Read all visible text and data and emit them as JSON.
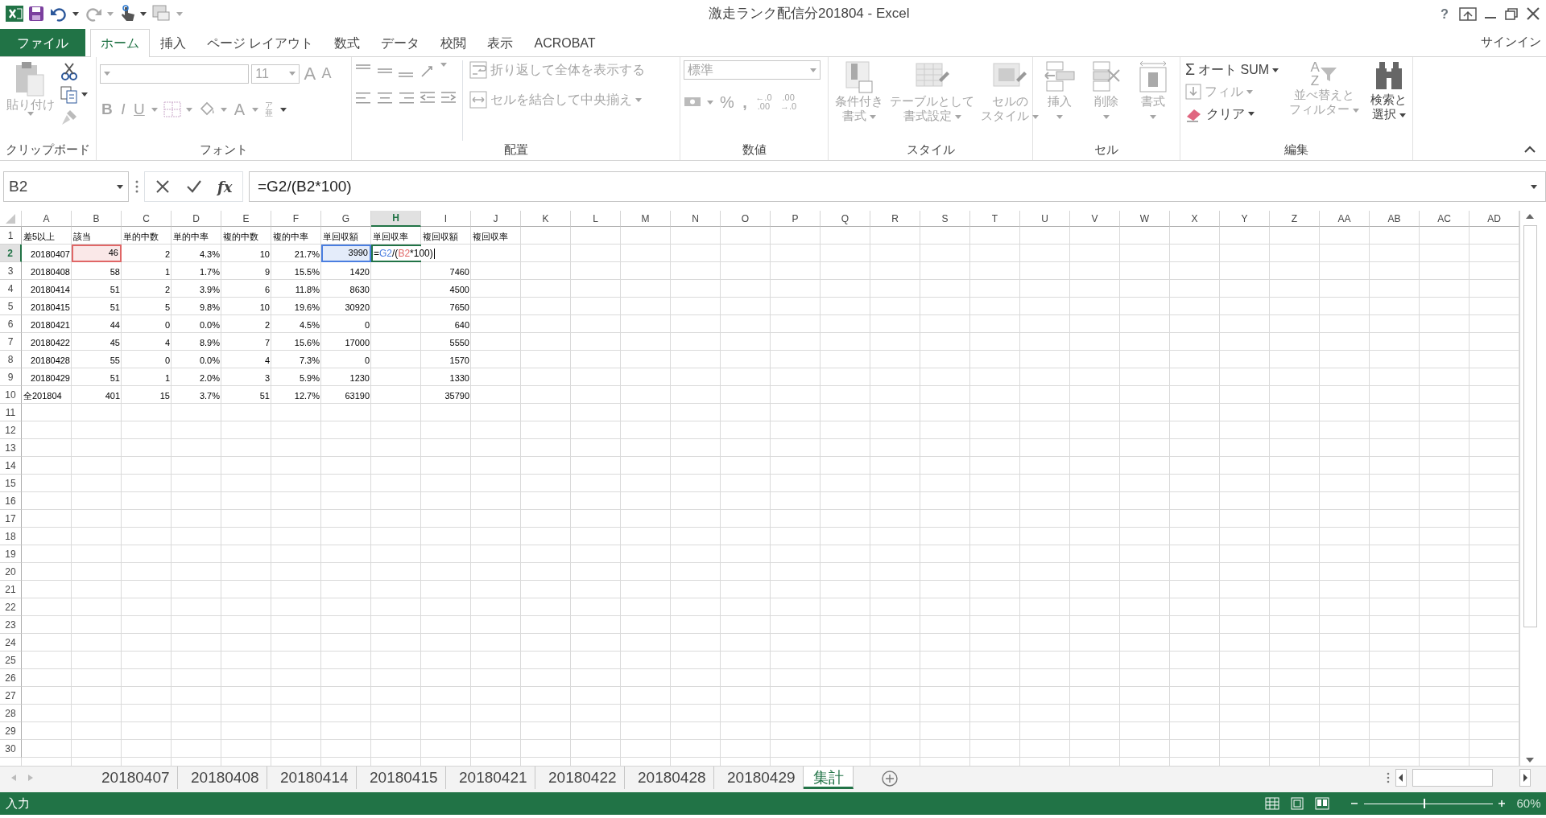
{
  "window": {
    "title": "激走ランク配信分201804 - Excel",
    "help": "?",
    "signin": "サインイン"
  },
  "ribbon_tabs": [
    {
      "label": "ファイル",
      "kind": "file",
      "selected": false
    },
    {
      "label": "ホーム",
      "kind": "tab",
      "selected": true
    },
    {
      "label": "挿入",
      "kind": "tab",
      "selected": false
    },
    {
      "label": "ページ レイアウト",
      "kind": "tab",
      "selected": false
    },
    {
      "label": "数式",
      "kind": "tab",
      "selected": false
    },
    {
      "label": "データ",
      "kind": "tab",
      "selected": false
    },
    {
      "label": "校閲",
      "kind": "tab",
      "selected": false
    },
    {
      "label": "表示",
      "kind": "tab",
      "selected": false
    },
    {
      "label": "ACROBAT",
      "kind": "tab",
      "selected": false
    }
  ],
  "ribbon": {
    "clipboard": {
      "label": "クリップボード",
      "paste": {
        "label": "貼り付け",
        "disabled": true
      }
    },
    "font": {
      "label": "フォント",
      "font_size": "11",
      "grow": "A",
      "shrink": "A",
      "bold": "B",
      "italic": "I",
      "underline": "U",
      "font_color": "A",
      "phonetic": [
        "ア",
        "亜"
      ],
      "disabled": true
    },
    "alignment": {
      "label": "配置",
      "wrap": "折り返して全体を表示する",
      "merge": "セルを結合して中央揃え",
      "disabled": true
    },
    "number": {
      "label": "数値",
      "format": "標準",
      "percent": "%",
      "comma": ",",
      "increase_decimal": [
        "←.0",
        ".00"
      ],
      "decrease_decimal": [
        ".00",
        "→.0"
      ],
      "disabled": true
    },
    "styles": {
      "label": "スタイル",
      "buttons": [
        {
          "lines": [
            "条件付き",
            "書式"
          ],
          "disabled": true
        },
        {
          "lines": [
            "テーブルとして",
            "書式設定"
          ],
          "disabled": true
        },
        {
          "lines": [
            "セルの",
            "スタイル"
          ],
          "disabled": true
        }
      ]
    },
    "cells": {
      "label": "セル",
      "buttons": [
        {
          "label": "挿入",
          "disabled": true
        },
        {
          "label": "削除",
          "disabled": true
        },
        {
          "label": "書式",
          "disabled": true
        }
      ]
    },
    "editing": {
      "label": "編集",
      "autosum": {
        "icon": "Σ",
        "label": "オート SUM",
        "disabled": false
      },
      "fill": {
        "label": "フィル",
        "disabled": true
      },
      "clear": {
        "label": "クリア",
        "disabled": false
      },
      "sort": {
        "letters": [
          "A",
          "Z"
        ],
        "lines": [
          "並べ替えと",
          "フィルター"
        ],
        "disabled": true
      },
      "find": {
        "lines": [
          "検索と",
          "選択"
        ],
        "disabled": false
      }
    }
  },
  "formula_bar": {
    "name_box": "B2",
    "fx": "fx",
    "formula": "=G2/(B2*100)"
  },
  "columns": [
    {
      "label": "A",
      "selected": false
    },
    {
      "label": "B",
      "selected": false
    },
    {
      "label": "C",
      "selected": false
    },
    {
      "label": "D",
      "selected": false
    },
    {
      "label": "E",
      "selected": false
    },
    {
      "label": "F",
      "selected": false
    },
    {
      "label": "G",
      "selected": false
    },
    {
      "label": "H",
      "selected": true
    },
    {
      "label": "I",
      "selected": false
    },
    {
      "label": "J",
      "selected": false
    },
    {
      "label": "K",
      "selected": false
    },
    {
      "label": "L",
      "selected": false
    },
    {
      "label": "M",
      "selected": false
    },
    {
      "label": "N",
      "selected": false
    },
    {
      "label": "O",
      "selected": false
    },
    {
      "label": "P",
      "selected": false
    },
    {
      "label": "Q",
      "selected": false
    },
    {
      "label": "R",
      "selected": false
    },
    {
      "label": "S",
      "selected": false
    },
    {
      "label": "T",
      "selected": false
    },
    {
      "label": "U",
      "selected": false
    },
    {
      "label": "V",
      "selected": false
    },
    {
      "label": "W",
      "selected": false
    },
    {
      "label": "X",
      "selected": false
    },
    {
      "label": "Y",
      "selected": false
    },
    {
      "label": "Z",
      "selected": false
    },
    {
      "label": "AA",
      "selected": false
    },
    {
      "label": "AB",
      "selected": false
    },
    {
      "label": "AC",
      "selected": false
    },
    {
      "label": "AD",
      "selected": false
    }
  ],
  "rows": [
    {
      "header": "1",
      "selected": false,
      "cells": [
        "差5以上",
        "該当",
        "単的中数",
        "単的中率",
        "複的中数",
        "複的中率",
        "単回収額",
        "単回収率",
        "複回収額",
        "複回収率"
      ]
    },
    {
      "header": "2",
      "selected": true,
      "cells": [
        "20180407",
        {
          "text": "46",
          "color": "#e06666"
        },
        "2",
        "4.3%",
        "10",
        "21.7%",
        {
          "text": "3990",
          "color": "#4a7ee0"
        },
        {
          "kind": "editing",
          "parts": [
            {
              "text": "="
            },
            {
              "text": "G2",
              "color": "#4a7ee0"
            },
            {
              "text": "/("
            },
            {
              "text": "B2",
              "color": "#e06666"
            },
            {
              "text": "*100)"
            }
          ]
        }
      ]
    },
    {
      "header": "3",
      "selected": false,
      "cells": [
        "20180408",
        "58",
        "1",
        "1.7%",
        "9",
        "15.5%",
        "1420",
        null,
        "7460"
      ]
    },
    {
      "header": "4",
      "selected": false,
      "cells": [
        "20180414",
        "51",
        "2",
        "3.9%",
        "6",
        "11.8%",
        "8630",
        null,
        "4500"
      ]
    },
    {
      "header": "5",
      "selected": false,
      "cells": [
        "20180415",
        "51",
        "5",
        "9.8%",
        "10",
        "19.6%",
        "30920",
        null,
        "7650"
      ]
    },
    {
      "header": "6",
      "selected": false,
      "cells": [
        "20180421",
        "44",
        "0",
        "0.0%",
        "2",
        "4.5%",
        "0",
        null,
        "640"
      ]
    },
    {
      "header": "7",
      "selected": false,
      "cells": [
        "20180422",
        "45",
        "4",
        "8.9%",
        "7",
        "15.6%",
        "17000",
        null,
        "5550"
      ]
    },
    {
      "header": "8",
      "selected": false,
      "cells": [
        "20180428",
        "55",
        "0",
        "0.0%",
        "4",
        "7.3%",
        "0",
        null,
        "1570"
      ]
    },
    {
      "header": "9",
      "selected": false,
      "cells": [
        "20180429",
        "51",
        "1",
        "2.0%",
        "3",
        "5.9%",
        "1230",
        null,
        "1330"
      ]
    },
    {
      "header": "10",
      "selected": false,
      "cells": [
        "全201804",
        "401",
        "15",
        "3.7%",
        "51",
        "12.7%",
        "63190",
        null,
        "35790"
      ]
    },
    {
      "header": "11",
      "selected": false
    },
    {
      "header": "12",
      "selected": false
    },
    {
      "header": "13",
      "selected": false
    },
    {
      "header": "14",
      "selected": false
    },
    {
      "header": "15",
      "selected": false
    },
    {
      "header": "16",
      "selected": false
    },
    {
      "header": "17",
      "selected": false
    },
    {
      "header": "18",
      "selected": false
    },
    {
      "header": "19",
      "selected": false
    },
    {
      "header": "20",
      "selected": false
    },
    {
      "header": "21",
      "selected": false
    },
    {
      "header": "22",
      "selected": false
    },
    {
      "header": "23",
      "selected": false
    },
    {
      "header": "24",
      "selected": false
    },
    {
      "header": "25",
      "selected": false
    },
    {
      "header": "26",
      "selected": false
    },
    {
      "header": "27",
      "selected": false
    },
    {
      "header": "28",
      "selected": false
    },
    {
      "header": "29",
      "selected": false
    },
    {
      "header": "30",
      "selected": false
    }
  ],
  "sheet_tabs": [
    {
      "label": "20180407",
      "selected": false
    },
    {
      "label": "20180408",
      "selected": false
    },
    {
      "label": "20180414",
      "selected": false
    },
    {
      "label": "20180415",
      "selected": false
    },
    {
      "label": "20180421",
      "selected": false
    },
    {
      "label": "20180422",
      "selected": false
    },
    {
      "label": "20180428",
      "selected": false
    },
    {
      "label": "20180429",
      "selected": false
    },
    {
      "label": "集計",
      "selected": true
    }
  ],
  "status_bar": {
    "mode": "入力",
    "zoom_slider": {
      "level": 0.47
    },
    "zoom": "60%"
  }
}
